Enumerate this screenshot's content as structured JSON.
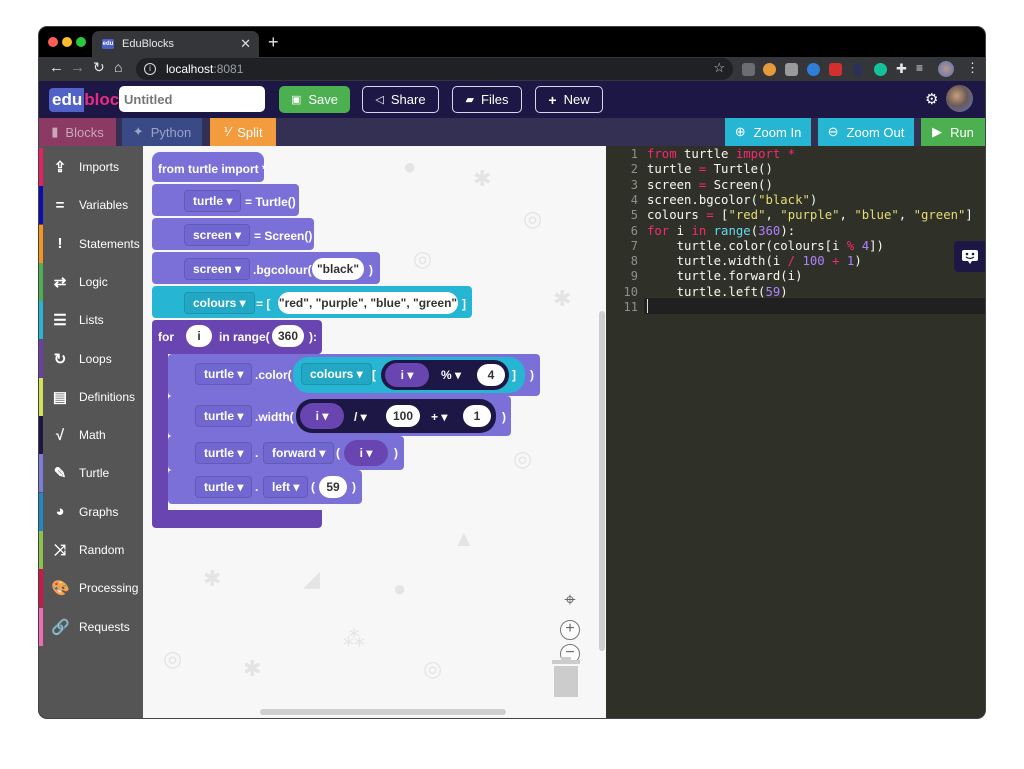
{
  "browser": {
    "tab_title": "EduBlocks",
    "tab_favicon": "edu",
    "url_host": "localhost",
    "url_port": ":8081",
    "traffic_colors": [
      "#ff5f57",
      "#febc2e",
      "#28c840"
    ]
  },
  "header": {
    "logo_edu": "edu",
    "logo_blocks": "blocks",
    "title_value": "Untitled",
    "buttons": {
      "save": "Save",
      "share": "Share",
      "files": "Files",
      "new": "New"
    }
  },
  "toolbar": {
    "tabs": {
      "blocks": "Blocks",
      "python": "Python",
      "split": "Split"
    },
    "zoom_in": "Zoom In",
    "zoom_out": "Zoom Out",
    "run": "Run",
    "colors": {
      "blocks": "#8a3a63",
      "python": "#3a4a86",
      "split": "#f39c3d",
      "zoom": "#26b5d3",
      "run": "#4caf50"
    }
  },
  "toolbox": {
    "categories": [
      {
        "label": "Imports",
        "icon": "upload-icon",
        "color": "#e91e63"
      },
      {
        "label": "Variables",
        "icon": "equals-icon",
        "color": "#0c0cb3"
      },
      {
        "label": "Statements",
        "icon": "exclamation-icon",
        "color": "#f7931e"
      },
      {
        "label": "Logic",
        "icon": "exchange-icon",
        "color": "#4caf50"
      },
      {
        "label": "Lists",
        "icon": "list-icon",
        "color": "#26b5d3"
      },
      {
        "label": "Loops",
        "icon": "redo-icon",
        "color": "#6a40a8"
      },
      {
        "label": "Definitions",
        "icon": "book-icon",
        "color": "#d4e157"
      },
      {
        "label": "Math",
        "icon": "square-root-icon",
        "color": "#1d1745"
      },
      {
        "label": "Turtle",
        "icon": "pencil-icon",
        "color": "#7b7be0"
      },
      {
        "label": "Graphs",
        "icon": "pie-chart-icon",
        "color": "#1e88c8"
      },
      {
        "label": "Random",
        "icon": "shuffle-icon",
        "color": "#8bc34a"
      },
      {
        "label": "Processing",
        "icon": "palette-icon",
        "color": "#d0154d"
      },
      {
        "label": "Requests",
        "icon": "link-icon",
        "color": "#f06ab5"
      }
    ]
  },
  "blocks": {
    "import": "from turtle import *",
    "turtle_var": "turtle",
    "turtle_assign": "= Turtle()",
    "screen_var": "screen",
    "screen_assign": "= Screen()",
    "screen_var2": "screen",
    "bgcolour": ".bgcolour(",
    "bgcolour_value": "\"black\"",
    "close_paren": ")",
    "colours_var": "colours",
    "colours_assign": "= [",
    "colours_value": "\"red\", \"purple\", \"blue\", \"green\"",
    "close_bracket": "]",
    "for_kw": "for",
    "for_var": "i",
    "in_range": "in range(",
    "range_value": "360",
    "range_close": "):",
    "color_obj": "turtle",
    "color_method": ".color(",
    "color_list": "colours",
    "open_bracket": "[",
    "mod_var": "i",
    "mod_op": "%",
    "mod_value": "4",
    "width_obj": "turtle",
    "width_method": ".width(",
    "div_var": "i",
    "div_op": "/",
    "div_value": "100",
    "add_op": "+",
    "add_value": "1",
    "forward_obj": "turtle",
    "dot": ".",
    "forward_method": "forward",
    "open_paren": "(",
    "forward_arg": "i",
    "left_obj": "turtle",
    "left_method": "left",
    "left_value": "59"
  },
  "editor": {
    "line_numbers": [
      "1",
      "2",
      "3",
      "4",
      "5",
      "6",
      "7",
      "8",
      "9",
      "10",
      "11"
    ],
    "lines": [
      [
        {
          "t": "from",
          "c": "kw"
        },
        {
          "t": " turtle ",
          "c": ""
        },
        {
          "t": "import",
          "c": "kw"
        },
        {
          "t": " *",
          "c": "op"
        }
      ],
      [
        {
          "t": "turtle ",
          "c": ""
        },
        {
          "t": "=",
          "c": "op"
        },
        {
          "t": " Turtle()",
          "c": ""
        }
      ],
      [
        {
          "t": "screen ",
          "c": ""
        },
        {
          "t": "=",
          "c": "op"
        },
        {
          "t": " Screen()",
          "c": ""
        }
      ],
      [
        {
          "t": "screen.bgcolor(",
          "c": ""
        },
        {
          "t": "\"black\"",
          "c": "str"
        },
        {
          "t": ")",
          "c": ""
        }
      ],
      [
        {
          "t": "colours ",
          "c": ""
        },
        {
          "t": "=",
          "c": "op"
        },
        {
          "t": " [",
          "c": ""
        },
        {
          "t": "\"red\"",
          "c": "str"
        },
        {
          "t": ", ",
          "c": ""
        },
        {
          "t": "\"purple\"",
          "c": "str"
        },
        {
          "t": ", ",
          "c": ""
        },
        {
          "t": "\"blue\"",
          "c": "str"
        },
        {
          "t": ", ",
          "c": ""
        },
        {
          "t": "\"green\"",
          "c": "str"
        },
        {
          "t": "]",
          "c": ""
        }
      ],
      [
        {
          "t": "for",
          "c": "kw"
        },
        {
          "t": " i ",
          "c": ""
        },
        {
          "t": "in",
          "c": "kw"
        },
        {
          "t": " ",
          "c": ""
        },
        {
          "t": "range",
          "c": "fn"
        },
        {
          "t": "(",
          "c": ""
        },
        {
          "t": "360",
          "c": "num"
        },
        {
          "t": "):",
          "c": ""
        }
      ],
      [
        {
          "t": "    turtle.color(colours[i ",
          "c": ""
        },
        {
          "t": "%",
          "c": "op"
        },
        {
          "t": " ",
          "c": ""
        },
        {
          "t": "4",
          "c": "num"
        },
        {
          "t": "])",
          "c": ""
        }
      ],
      [
        {
          "t": "    turtle.width(i ",
          "c": ""
        },
        {
          "t": "/",
          "c": "op"
        },
        {
          "t": " ",
          "c": ""
        },
        {
          "t": "100",
          "c": "num"
        },
        {
          "t": " ",
          "c": ""
        },
        {
          "t": "+",
          "c": "op"
        },
        {
          "t": " ",
          "c": ""
        },
        {
          "t": "1",
          "c": "num"
        },
        {
          "t": ")",
          "c": ""
        }
      ],
      [
        {
          "t": "    turtle.forward(i)",
          "c": ""
        }
      ],
      [
        {
          "t": "    turtle.left(",
          "c": ""
        },
        {
          "t": "59",
          "c": "num"
        },
        {
          "t": ")",
          "c": ""
        }
      ],
      [
        {
          "t": "",
          "c": ""
        }
      ]
    ]
  }
}
